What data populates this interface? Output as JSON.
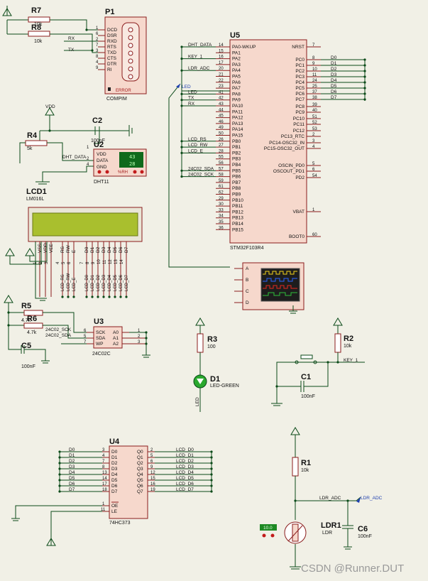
{
  "p1": {
    "ref": "P1",
    "type": "COMPIM",
    "error": "ERROR",
    "pins": [
      "DCD",
      "DSR",
      "RXD",
      "RTS",
      "TXD",
      "CTS",
      "DTR",
      "RI"
    ],
    "nums": [
      "1",
      "6",
      "2",
      "7",
      "3",
      "8",
      "4",
      "9"
    ]
  },
  "r7": {
    "ref": "R7",
    "value": "10k"
  },
  "r8": {
    "ref": "R8",
    "value": "10k"
  },
  "rx": "RX",
  "tx": "TX",
  "vdd": "VDD",
  "r4": {
    "ref": "R4",
    "value": "5k"
  },
  "c2": {
    "ref": "C2",
    "value": "100nF"
  },
  "u2": {
    "ref": "U2",
    "type": "DHT11",
    "pins": [
      "VDD",
      "DATA",
      "GND"
    ],
    "nums": [
      "1",
      "2",
      "4"
    ],
    "temp": "43",
    "hum": "28",
    "unit_left": "°C",
    "unit_right": "%RH"
  },
  "dht_data": "DHT_DATA",
  "lcd1": {
    "ref": "LCD1",
    "type": "LM016L",
    "pins": [
      "VSS",
      "VDD",
      "VEE",
      "RS",
      "RW",
      "E",
      "D0",
      "D1",
      "D2",
      "D3",
      "D4",
      "D5",
      "D6",
      "D7"
    ],
    "nums": [
      "1",
      "2",
      "3",
      "4",
      "5",
      "6",
      "7",
      "8",
      "9",
      "10",
      "11",
      "12",
      "13",
      "14"
    ],
    "nets": [
      "LCD_RS",
      "LCD_RW",
      "LCD_E",
      "LCD_D0",
      "LCD_D1",
      "LCD_D2",
      "LCD_D3",
      "LCD_D4",
      "LCD_D5",
      "LCD_D6",
      "LCD_D7"
    ]
  },
  "u5": {
    "ref": "U5",
    "type": "STM32F103R4",
    "left_pins": [
      "PA0-WKUP",
      "PA1",
      "PA2",
      "PA3",
      "PA4",
      "PA5",
      "PA6",
      "PA7",
      "PA8",
      "PA9",
      "PA10",
      "PA11",
      "PA12",
      "PA13",
      "PA14",
      "PA15",
      "PB0",
      "PB1",
      "PB2",
      "PB3",
      "PB4",
      "PB5",
      "PB6",
      "PB7",
      "PB8",
      "PB9",
      "PB10",
      "PB11",
      "PB12",
      "PB13",
      "PB14",
      "PB15"
    ],
    "left_nums": [
      "14",
      "15",
      "16",
      "17",
      "20",
      "21",
      "22",
      "23",
      "41",
      "42",
      "43",
      "44",
      "45",
      "46",
      "49",
      "50",
      "26",
      "27",
      "28",
      "55",
      "56",
      "57",
      "58",
      "59",
      "61",
      "62",
      "29",
      "30",
      "33",
      "34",
      "35",
      "36"
    ],
    "right_pins": [
      "NRST",
      "PC0",
      "PC1",
      "PC2",
      "PC3",
      "PC4",
      "PC5",
      "PC6",
      "PC7",
      "PC8",
      "PC9",
      "PC10",
      "PC11",
      "PC12",
      "PC13_RTC",
      "PC14-OSC32_IN",
      "PC15-OSC32_OUT",
      "OSCIN_PD0",
      "OSCOUT_PD1",
      "PD2",
      "VBAT",
      "BOOT0"
    ],
    "right_nums": [
      "7",
      "8",
      "9",
      "10",
      "11",
      "24",
      "25",
      "37",
      "38",
      "39",
      "40",
      "51",
      "52",
      "53",
      "2",
      "3",
      "4",
      "5",
      "6",
      "54",
      "1",
      "60"
    ],
    "left_nets": [
      "DHT_DATA",
      "",
      "KEY_1",
      "",
      "LDR_ADC",
      "",
      "",
      "",
      "LED",
      "TX",
      "RX",
      "",
      "",
      "",
      "",
      "",
      "LCD_RS",
      "LCD_RW",
      "LCD_E",
      "",
      "24C02_SDA",
      "24C02_SCK"
    ],
    "right_nets": [
      "D0",
      "D1",
      "D2",
      "D3",
      "D4",
      "D5",
      "D6",
      "D7"
    ]
  },
  "led_net": "LED",
  "scope": {
    "channels": [
      "A",
      "B",
      "C",
      "D"
    ]
  },
  "r5": {
    "ref": "R5",
    "value": "4.7k"
  },
  "r6": {
    "ref": "R6",
    "value": "4.7k"
  },
  "c5": {
    "ref": "C5",
    "value": "100nF"
  },
  "u3": {
    "ref": "U3",
    "type": "24C02C",
    "pins_l": [
      "SCK",
      "SDA",
      "WP"
    ],
    "nums_l": [
      "6",
      "5",
      "7"
    ],
    "pins_r": [
      "A0",
      "A1",
      "A2"
    ],
    "nums_r": [
      "1",
      "2",
      "3"
    ]
  },
  "sck_net": "24C02_SCK",
  "sda_net": "24C02_SDA",
  "r3": {
    "ref": "R3",
    "value": "100"
  },
  "d1": {
    "ref": "D1",
    "value": "LED-GREEN"
  },
  "r2": {
    "ref": "R2",
    "value": "10k"
  },
  "c1": {
    "ref": "C1",
    "value": "100nF"
  },
  "key1": "KEY_1",
  "u4": {
    "ref": "U4",
    "type": "74HC373",
    "pins_l": [
      "D0",
      "D1",
      "D2",
      "D3",
      "D4",
      "D5",
      "D6",
      "D7"
    ],
    "nums_l": [
      "3",
      "4",
      "7",
      "8",
      "13",
      "14",
      "17",
      "18"
    ],
    "pins_r": [
      "Q0",
      "Q1",
      "Q2",
      "Q3",
      "Q4",
      "Q5",
      "Q6",
      "Q7"
    ],
    "nums_r": [
      "2",
      "5",
      "6",
      "9",
      "12",
      "15",
      "16",
      "19"
    ],
    "oe": "OE",
    "le": "LE",
    "oe_num": "1",
    "le_num": "11",
    "in_nets": [
      "D0",
      "D1",
      "D2",
      "D3",
      "D4",
      "D5",
      "D6",
      "D7"
    ],
    "out_nets": [
      "LCD_D0",
      "LCD_D1",
      "LCD_D2",
      "LCD_D3",
      "LCD_D4",
      "LCD_D5",
      "LCD_D6",
      "LCD_D7"
    ]
  },
  "r1": {
    "ref": "R1",
    "value": "10k"
  },
  "ldr1": {
    "ref": "LDR1",
    "value": "LDR",
    "reading": "10.0"
  },
  "c6": {
    "ref": "C6",
    "value": "100nF"
  },
  "ldr_adc": "LDR_ADC",
  "watermark": "CSDN @Runner.DUT"
}
